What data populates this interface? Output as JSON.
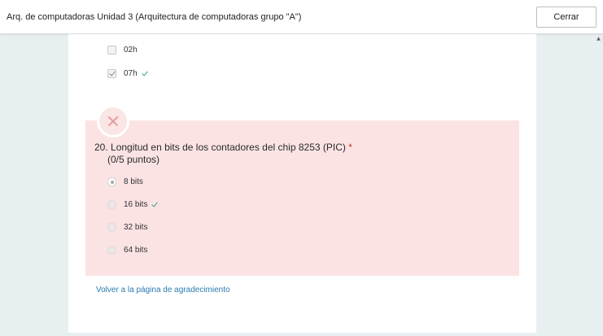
{
  "header": {
    "title": "Arq. de computadoras Unidad 3 (Arquitectura de computadoras grupo \"A\")",
    "close_label": "Cerrar"
  },
  "prev_question": {
    "options": [
      {
        "label": "02h",
        "checked": false,
        "correct": false
      },
      {
        "label": "07h",
        "checked": true,
        "correct": true
      }
    ]
  },
  "question": {
    "number": "20.",
    "text": "Longitud en bits de los contadores del chip 8253 (PIC)",
    "required_mark": "*",
    "points": "(0/5 puntos)",
    "status": "incorrect",
    "options": [
      {
        "label": "8 bits",
        "selected": true,
        "correct": false
      },
      {
        "label": "16 bits",
        "selected": false,
        "correct": true
      },
      {
        "label": "32 bits",
        "selected": false,
        "correct": false
      },
      {
        "label": "64 bits",
        "selected": false,
        "correct": false
      }
    ]
  },
  "footer": {
    "back_link": "Volver a la página de agradecimiento"
  },
  "colors": {
    "incorrect_bg": "#fbe3e4",
    "correct_tick": "#2fa39b",
    "link": "#2a7ab0",
    "page_bg": "#e8eff0"
  }
}
